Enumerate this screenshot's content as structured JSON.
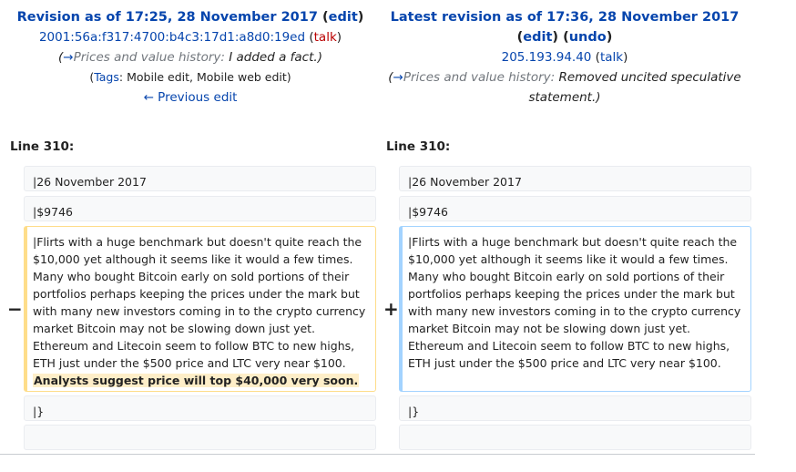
{
  "left": {
    "title_prefix": "Revision as of 17:25, 28 November 2017",
    "edit_link": "edit",
    "user": "2001:56a:f317:4700:b4c3:17d1:a8d0:19ed",
    "talk": "talk",
    "comment_section": "Prices and value history:",
    "comment_text": " I added a fact.)",
    "tags_label": "Tags",
    "tags_value": ": Mobile edit, Mobile web edit)",
    "prev_link": "← Previous edit"
  },
  "right": {
    "title": "Latest revision as of 17:36, 28 November 2017",
    "edit_link": "edit",
    "undo_link": "undo",
    "user": "205.193.94.40",
    "talk": "talk",
    "comment_section": "Prices and value history:",
    "comment_text": "  Removed uncited speculative",
    "comment_text2": "statement.)"
  },
  "diff": {
    "left_lineno": "Line 310:",
    "right_lineno": "Line 310:",
    "ctx1": "|26 November 2017",
    "ctx2": "|$9746",
    "ctx3": "|}",
    "minus": "−",
    "plus": "+",
    "left_changed_text": "|Flirts with a huge benchmark but doesn't quite reach the $10,000 yet although it seems like it would a few times. Many who bought Bitcoin early on sold portions of their portfolios perhaps keeping the prices under the mark but with many new investors coming in to the crypto currency market Bitcoin may not be slowing down just yet. Ethereum and Litecoin seem to follow BTC to new highs, ETH just under the $500 price and LTC very near $100.",
    "left_removed_text": "Analysts suggest price will top $40,000 very soon.",
    "right_changed_text": "|Flirts with a huge benchmark but doesn't quite reach the $10,000 yet although it seems like it would a few times. Many who bought Bitcoin early on sold portions of their portfolios perhaps keeping the prices under the mark but with many new investors coming in to the crypto currency market Bitcoin may not be slowing down just yet. Ethereum and Litecoin seem to follow BTC to new highs, ETH just under the $500 price and LTC very near $100."
  }
}
